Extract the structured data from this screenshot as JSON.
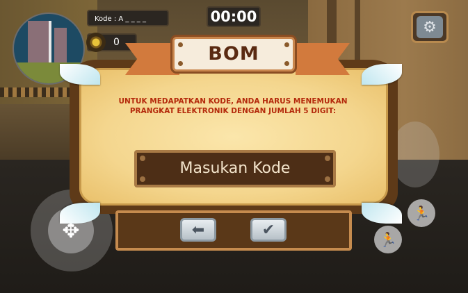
{
  "hud": {
    "code_label": "Kode : A _ _ _ _",
    "coins": "0",
    "timer": "00:00"
  },
  "dialog": {
    "title": "BOM",
    "instruction_line1": "UNTUK MEDAPATKAN KODE, ANDA HARUS MENEMUKAN",
    "instruction_line2": "PRANGKAT ELEKTRONIK DENGAN JUMLAH 5 DIGIT:",
    "input_placeholder": "Masukan Kode",
    "back_button_icon": "back-arrow-icon",
    "confirm_button_icon": "checkmark-icon"
  },
  "colors": {
    "dialog_frame": "#5e3a18",
    "dialog_paper": "#f4d68e",
    "instruction_text": "#b42a0c",
    "title_text": "#5a2a12"
  }
}
